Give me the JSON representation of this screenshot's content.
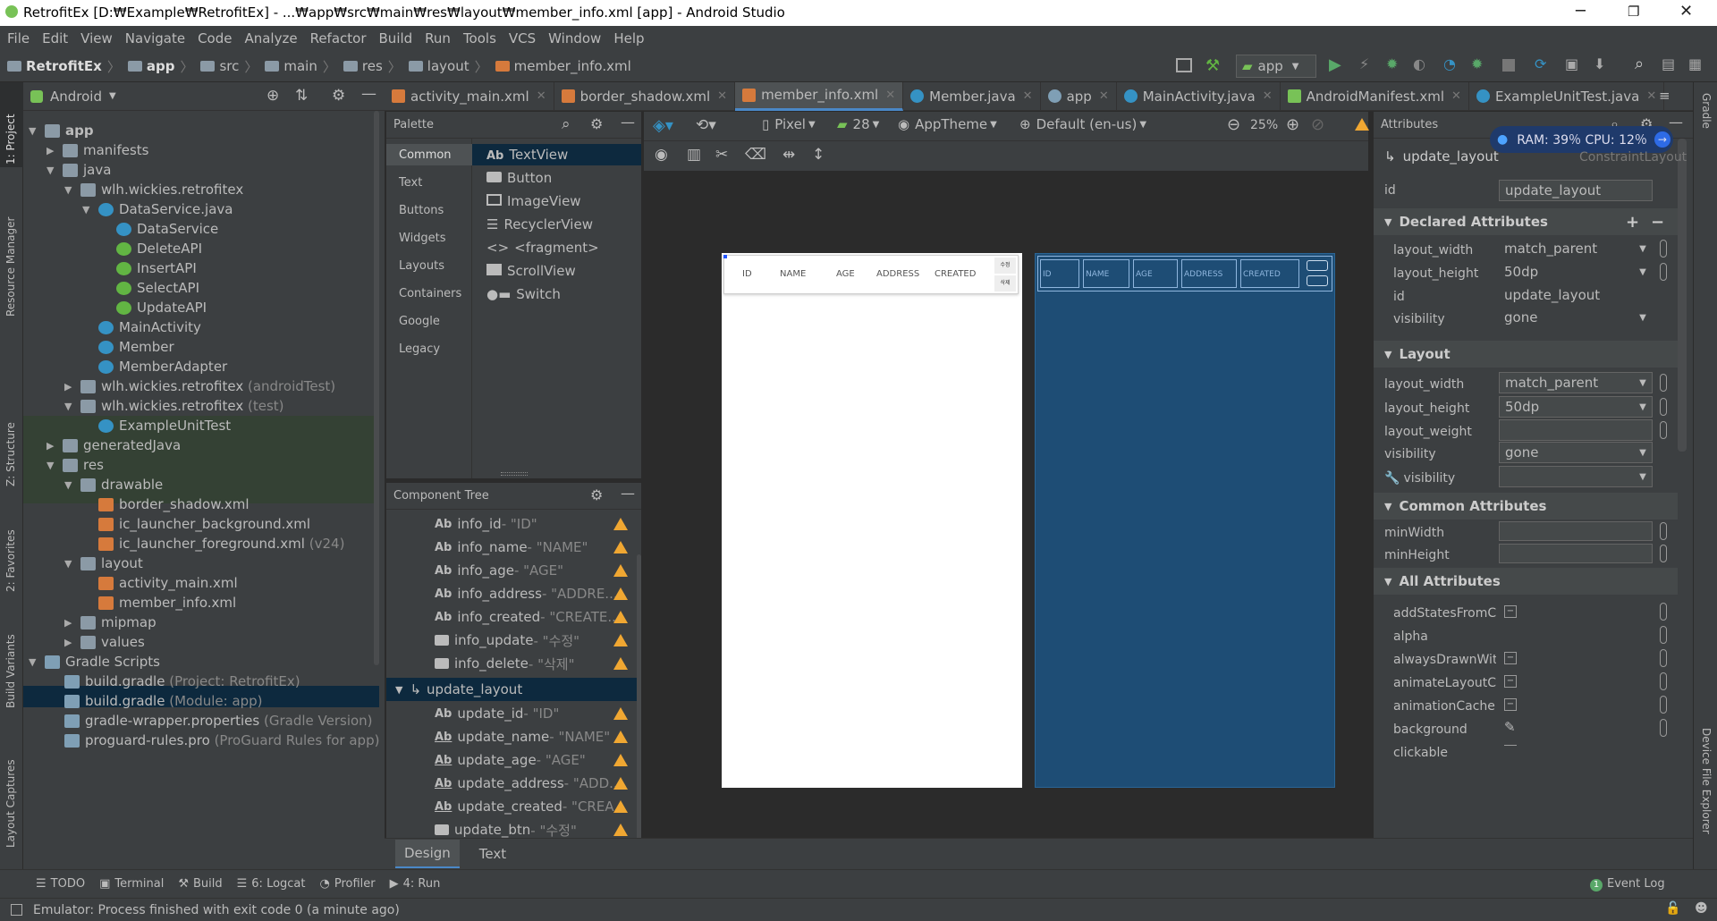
{
  "window": {
    "title": "RetrofitEx [D:₩Example₩RetrofitEx] - ...₩app₩src₩main₩res₩layout₩member_info.xml [app] - Android Studio"
  },
  "menu": [
    "File",
    "Edit",
    "View",
    "Navigate",
    "Code",
    "Analyze",
    "Refactor",
    "Build",
    "Run",
    "Tools",
    "VCS",
    "Window",
    "Help"
  ],
  "breadcrumb": [
    "RetrofitEx",
    "app",
    "src",
    "main",
    "res",
    "layout",
    "member_info.xml"
  ],
  "run_config": "app",
  "project_panel": {
    "view": "Android"
  },
  "tree": [
    "app",
    "manifests",
    "java",
    "wlh.wickies.retrofitex",
    "DataService.java",
    "DataService",
    "DeleteAPI",
    "InsertAPI",
    "SelectAPI",
    "UpdateAPI",
    "MainActivity",
    "Member",
    "MemberAdapter",
    "wlh.wickies.retrofitex",
    "(androidTest)",
    "wlh.wickies.retrofitex",
    "(test)",
    "ExampleUnitTest",
    "generatedJava",
    "res",
    "drawable",
    "border_shadow.xml",
    "ic_launcher_background.xml",
    "ic_launcher_foreground.xml",
    "(v24)",
    "layout",
    "activity_main.xml",
    "member_info.xml",
    "mipmap",
    "values",
    "Gradle Scripts",
    "build.gradle",
    "(Project: RetrofitEx)",
    "build.gradle",
    "(Module: app)",
    "gradle-wrapper.properties",
    "(Gradle Version)",
    "proguard-rules.pro",
    "(ProGuard Rules for app)"
  ],
  "left_strip": [
    "1: Project",
    "Resource Manager",
    "Z: Structure",
    "2: Favorites",
    "Build Variants",
    "Layout Captures"
  ],
  "right_strip": [
    "Gradle",
    "Device File Explorer"
  ],
  "editor_tabs": [
    "activity_main.xml",
    "border_shadow.xml",
    "member_info.xml",
    "Member.java",
    "app",
    "MainActivity.java",
    "AndroidManifest.xml",
    "ExampleUnitTest.java"
  ],
  "palette": {
    "title": "Palette",
    "categories": [
      "Common",
      "Text",
      "Buttons",
      "Widgets",
      "Layouts",
      "Containers",
      "Google",
      "Legacy"
    ],
    "items": [
      "TextView",
      "Button",
      "ImageView",
      "RecyclerView",
      "<fragment>",
      "ScrollView",
      "Switch"
    ]
  },
  "component_tree": {
    "title": "Component Tree",
    "rows": [
      {
        "name": "info_id",
        "val": "- \"ID\""
      },
      {
        "name": "info_name",
        "val": "- \"NAME\""
      },
      {
        "name": "info_age",
        "val": "- \"AGE\""
      },
      {
        "name": "info_address",
        "val": "- \"ADDRE..."
      },
      {
        "name": "info_created",
        "val": "- \"CREATE..."
      },
      {
        "name": "info_update",
        "val": "- \"수정\""
      },
      {
        "name": "info_delete",
        "val": "- \"삭제\""
      },
      {
        "name": "update_layout",
        "val": ""
      },
      {
        "name": "update_id",
        "val": "- \"ID\""
      },
      {
        "name": "update_name",
        "val": "- \"NAME\""
      },
      {
        "name": "update_age",
        "val": "- \"AGE\""
      },
      {
        "name": "update_address",
        "val": "- \"ADD..."
      },
      {
        "name": "update_created",
        "val": "- \"CREA..."
      },
      {
        "name": "update_btn",
        "val": "- \"수정\""
      }
    ]
  },
  "design_toolbar": {
    "device": "Pixel",
    "api": "28",
    "theme": "AppTheme",
    "locale": "Default (en-us)",
    "zoom": "25%"
  },
  "preview": {
    "headers": [
      "ID",
      "NAME",
      "AGE",
      "ADDRESS",
      "CREATED"
    ],
    "btn1": "수정",
    "btn2": "삭제"
  },
  "attributes": {
    "title": "Attributes",
    "ram": "RAM: 39％ CPU: 12％",
    "component": "update_layout",
    "component_type": "ConstraintLayout",
    "id_label": "id",
    "id_value": "update_layout",
    "declared_title": "Declared Attributes",
    "declared": [
      {
        "k": "layout_width",
        "v": "match_parent"
      },
      {
        "k": "layout_height",
        "v": "50dp"
      },
      {
        "k": "id",
        "v": "update_layout"
      },
      {
        "k": "visibility",
        "v": "gone"
      }
    ],
    "layout_title": "Layout",
    "layout": [
      {
        "k": "layout_width",
        "v": "match_parent"
      },
      {
        "k": "layout_height",
        "v": "50dp"
      },
      {
        "k": "layout_weight",
        "v": ""
      },
      {
        "k": "visibility",
        "v": "gone"
      },
      {
        "k": "visibility",
        "v": ""
      }
    ],
    "common_title": "Common Attributes",
    "common": [
      {
        "k": "minWidth"
      },
      {
        "k": "minHeight"
      }
    ],
    "all_title": "All Attributes",
    "all": [
      "addStatesFromChi",
      "alpha",
      "alwaysDrawnWithC",
      "animateLayoutCha",
      "animationCache",
      "background",
      "clickable"
    ]
  },
  "bottom_tabs": [
    "Design",
    "Text"
  ],
  "tool_windows": [
    "TODO",
    "Terminal",
    "Build",
    "6: Logcat",
    "Profiler",
    "4: Run"
  ],
  "event_log": "Event Log",
  "status": "Emulator: Process finished with exit code 0 (a minute ago)"
}
